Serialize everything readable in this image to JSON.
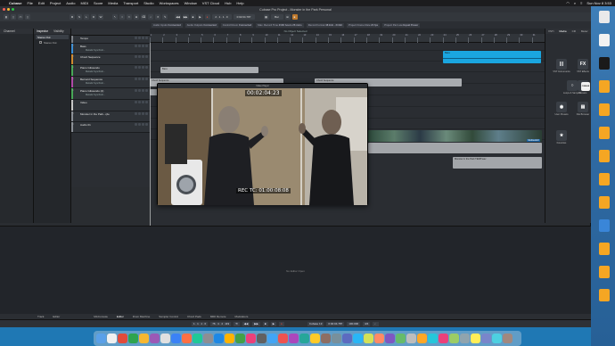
{
  "menubar": {
    "items": [
      "Cubase",
      "File",
      "Edit",
      "Project",
      "Audio",
      "MIDI",
      "Score",
      "Media",
      "Transport",
      "Studio",
      "Workspaces",
      "Window",
      "VST Cloud",
      "Hub",
      "Help"
    ],
    "clock": "Sun Nov 8 3:53"
  },
  "window": {
    "title": "Cubase Pro Project - Monster in the Park Personal"
  },
  "toolbar": {
    "position": "2 . 1 . 1 . 0",
    "time": "0:02:04.787",
    "zoom": "Bar"
  },
  "infobar": {
    "fields": [
      "Audio Inputs",
      "Audio Outputs",
      "Control Room",
      "Max. Record Time",
      "Record Format",
      "Project Frame Rate",
      "Project Pan Law"
    ],
    "values": [
      "Connected",
      "Connected",
      "Connected",
      "2130 hours 26 mins",
      "48 kHz - 24 Bit",
      "24 fps",
      "Equal Power"
    ]
  },
  "status": "No Object Selected",
  "left_zone": {
    "tab": "Channel"
  },
  "inspector": {
    "tabs": [
      "Inspector",
      "Visibility"
    ],
    "selected_track": "Stereo Out",
    "row": "Stereo Out"
  },
  "tracks": [
    {
      "num": "1",
      "name": "Tempo",
      "sub": "",
      "color": "#7a7f86"
    },
    {
      "num": "2",
      "name": "Bass",
      "sub": "Melodic Synchrotr...",
      "color": "#3a8fd8"
    },
    {
      "num": "3",
      "name": "Chord Sequence",
      "sub": "",
      "color": "#d08a2f"
    },
    {
      "num": "4",
      "name": "Piano Glissando",
      "sub": "Melodic Synchrotr...",
      "color": "#48a858"
    },
    {
      "num": "5",
      "name": "Bernard Sequence",
      "sub": "Melodic Synchrotr...",
      "color": "#b04aa8"
    },
    {
      "num": "6",
      "name": "Piano Glissando (2)",
      "sub": "Melodic Synchrotr...",
      "color": "#48a858"
    },
    {
      "num": "7",
      "name": "Video",
      "sub": "",
      "color": "#c8c8c8"
    },
    {
      "num": "8",
      "name": "Monster in the Park...(de",
      "sub": "",
      "color": "#8a8f96"
    },
    {
      "num": "9",
      "name": "Audio 01",
      "sub": "",
      "color": "#8a8f96"
    }
  ],
  "ruler": {
    "labels": [
      "1",
      "2",
      "3",
      "4",
      "5",
      "6",
      "7",
      "8",
      "9",
      "10",
      "11",
      "12",
      "13",
      "14",
      "15",
      "16",
      "17",
      "18",
      "19",
      "20",
      "21",
      "22",
      "23",
      "24",
      "25",
      "26",
      "27",
      "28",
      "29",
      "30",
      "31"
    ]
  },
  "events": {
    "bass_label": "Bass",
    "chord_label": "Chord Sequence",
    "chord_label_2": "Chord Sequence",
    "top_right_label": "Bass",
    "audio_label": "Monster in the Park TEMP.wav",
    "thumb_label": "Multiswitch"
  },
  "video_player": {
    "title": "Video Player",
    "timecode": "00:02:04:23",
    "rec_tc": "REC TC: 01:00:08:08"
  },
  "right_zone": {
    "tabs": [
      "VSTi",
      "Media",
      "CR",
      "Meter"
    ],
    "tiles": [
      {
        "label": "VST Instruments",
        "glyph": "|||"
      },
      {
        "label": "VST Effects",
        "glyph": "FX"
      },
      {
        "label": "Loops & Samples",
        "glyph": "○"
      },
      {
        "label": "Presets",
        "glyph": "◐"
      },
      {
        "label": "User Presets",
        "glyph": "◉"
      },
      {
        "label": "File Browser",
        "glyph": "▤"
      },
      {
        "label": "Favorites",
        "glyph": "★"
      }
    ],
    "notice": "CUBASE"
  },
  "lower_zone": {
    "empty": "No Editor Open",
    "tabs": [
      "Track",
      "Editor",
      "MixConsole",
      "Editor",
      "Drum Machine",
      "Sampler Control",
      "Chord Pads",
      "MIDI Remote",
      "Modulators"
    ]
  },
  "transport": {
    "left_pos": "1 . 1 . 1 . 0",
    "right_pos": "76 . 4 . 4 . 119",
    "main_time": "0:02:04.787",
    "tempo": "100.000",
    "sig": "4/4",
    "project_name": "Cubase 13"
  },
  "desktop_icons": [
    {
      "label": "",
      "color": "#e9e9ea"
    },
    {
      "label": "",
      "color": "#f2f2f2"
    },
    {
      "label": "",
      "color": "#1a1a1a"
    },
    {
      "label": "",
      "color": "#f5a623"
    },
    {
      "label": "",
      "color": "#f5a623"
    },
    {
      "label": "",
      "color": "#f5a623"
    },
    {
      "label": "",
      "color": "#f5a623"
    },
    {
      "label": "",
      "color": "#f5a623"
    },
    {
      "label": "",
      "color": "#f5a623"
    },
    {
      "label": "",
      "color": "#3a86d8"
    },
    {
      "label": "",
      "color": "#f5a623"
    },
    {
      "label": "",
      "color": "#f5a623"
    },
    {
      "label": "",
      "color": "#f5a623"
    }
  ],
  "dock_colors": [
    "#5aa0e8",
    "#f0f0f0",
    "#e24b3b",
    "#2ea44f",
    "#f7b731",
    "#9b59b6",
    "#e0e0e0",
    "#3b82f6",
    "#ff7043",
    "#20c997",
    "#8e8e93",
    "#1e88e5",
    "#ffb300",
    "#43a047",
    "#ec407a",
    "#616161",
    "#42a5f5",
    "#ef5350",
    "#ab47bc",
    "#26a69a",
    "#ffca28",
    "#8d6e63",
    "#78909c",
    "#5c6bc0",
    "#29b6f6",
    "#d4e157",
    "#ff8a65",
    "#7e57c2",
    "#66bb6a",
    "#bdbdbd",
    "#ffa726",
    "#26c6da",
    "#ec407a",
    "#9ccc65",
    "#90a4ae",
    "#ffee58",
    "#7986cb",
    "#4dd0e1",
    "#a1887f"
  ]
}
